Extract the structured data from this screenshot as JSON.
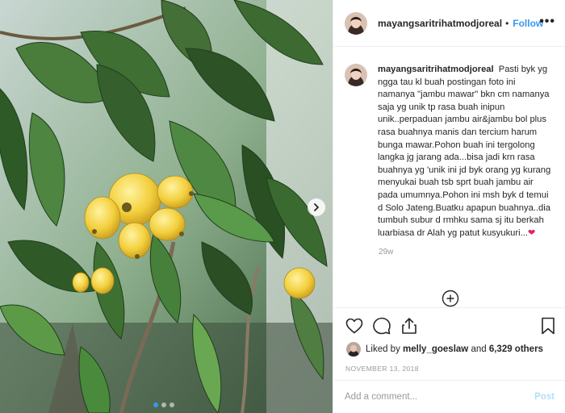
{
  "post": {
    "username": "mayangsaritrihatmodjoreal",
    "header_separator": "•",
    "follow_label": "Follow",
    "more_label": "•••",
    "caption_username": "mayangsaritrihatmodjoreal",
    "caption_text": "Pasti byk yg ngga tau kl buah postingan foto ini namanya \"jambu mawar\" bkn cm namanya saja yg unik tp rasa buah inipun unik..perpaduan jambu air&jambu bol plus rasa buahnya manis dan tercium harum bunga mawar.Pohon buah ini tergolong langka jg jarang ada...bisa jadi krn rasa buahnya yg 'unik ini jd byk orang yg kurang menyukai buah tsb sprt buah jambu air pada umumnya.Pohon ini msh byk d temui d Solo Jateng.Buatku apapun buahnya..dia tumbuh subur d rmhku sama sj itu berkah luarbiasa dr Alah yg patut kusyukuri...",
    "caption_emoji": "❤",
    "time_ago": "29w",
    "liked_prefix": "Liked by ",
    "liked_user": "melly_goeslaw",
    "liked_middle": " and ",
    "liked_count": "6,329 others",
    "date": "NOVEMBER 13, 2018",
    "comment_placeholder": "Add a comment...",
    "post_label": "Post"
  },
  "carousel": {
    "total": 3,
    "active": 1
  },
  "icons": {
    "like": "heart-icon",
    "comment": "comment-icon",
    "share": "share-icon",
    "save": "bookmark-icon",
    "load_more": "plus-circle-icon",
    "next": "chevron-right-icon"
  },
  "colors": {
    "accent": "#3897f0",
    "post_disabled": "#b2dffc",
    "meta": "#999999",
    "text": "#262626"
  }
}
